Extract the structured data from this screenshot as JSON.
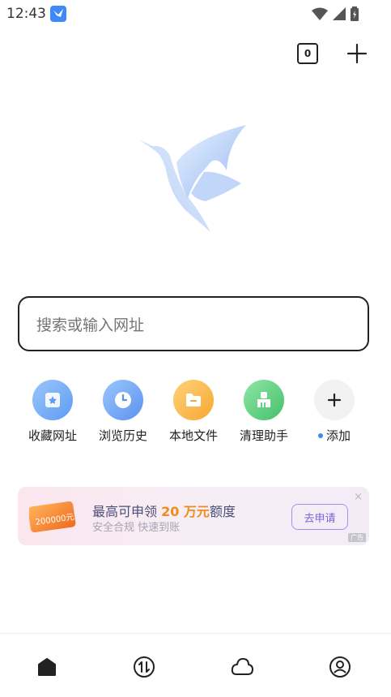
{
  "status_bar": {
    "time": "12:43",
    "icons": [
      "app-notification-icon",
      "wifi-icon",
      "cell-signal-icon",
      "battery-icon"
    ]
  },
  "toolbar": {
    "tab_count": "0",
    "icons": [
      "tab-switcher-icon",
      "new-tab-plus-icon"
    ]
  },
  "search": {
    "placeholder": "搜索或输入网址"
  },
  "shortcuts": [
    {
      "label": "收藏网址",
      "icon": "bookmark-star-icon",
      "color": "#6aa6f6"
    },
    {
      "label": "浏览历史",
      "icon": "clock-icon",
      "color": "#5b9af4"
    },
    {
      "label": "本地文件",
      "icon": "folder-icon",
      "color": "#f8b340"
    },
    {
      "label": "清理助手",
      "icon": "broom-icon",
      "color": "#56cf7d"
    },
    {
      "label": "添加",
      "icon": "plus-icon",
      "color": "#f2f2f2"
    }
  ],
  "ad": {
    "title_prefix": "最高可申领 ",
    "title_highlight": "20 万元",
    "title_suffix": "额度",
    "subtitle": "安全合规 快速到账",
    "button": "去申请",
    "close": "×",
    "tag": "广告",
    "coupon_text": "200000元"
  },
  "bottom_nav": [
    {
      "icon": "home-icon"
    },
    {
      "icon": "transfer-icon"
    },
    {
      "icon": "cloud-icon"
    },
    {
      "icon": "profile-icon"
    }
  ],
  "colors": {
    "accent": "#3d8af7",
    "highlight": "#f08a1e"
  }
}
